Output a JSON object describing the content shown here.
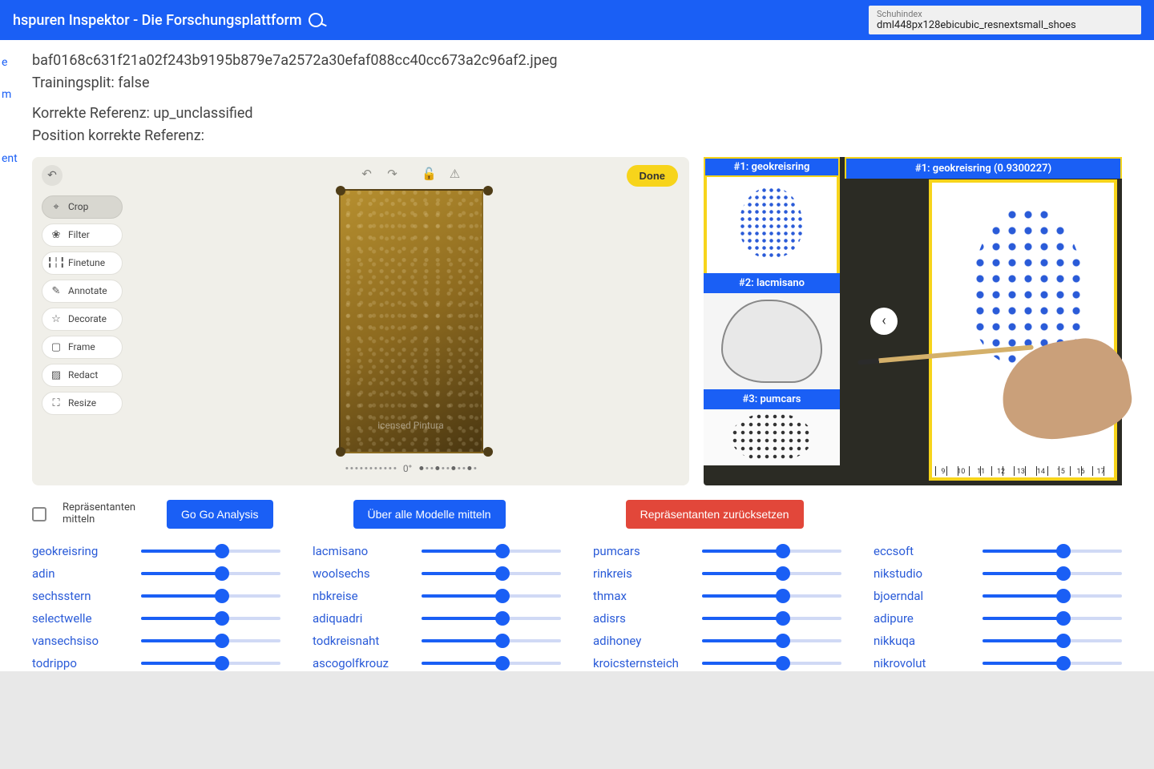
{
  "header": {
    "title": "hspuren Inspektor - Die Forschungsplattform",
    "index_label": "Schuhindex",
    "index_value": "dml448px128ebicubic_resnextsmall_shoes"
  },
  "meta": {
    "filename": "baf0168c631f21a02f243b9195b879e7a2572a30efaf088cc40cc673a2c96af2.jpeg",
    "split_label": "Trainingsplit: false",
    "ref_label": "Korrekte Referenz: up_unclassified",
    "pos_label": "Position korrekte Referenz:"
  },
  "editor": {
    "done": "Done",
    "watermark": "icensed Pintura",
    "angle": "0°",
    "tools": [
      {
        "icon": "⌖",
        "label": "Crop",
        "active": true
      },
      {
        "icon": "❀",
        "label": "Filter",
        "active": false
      },
      {
        "icon": "╏╎╏",
        "label": "Finetune",
        "active": false
      },
      {
        "icon": "✎",
        "label": "Annotate",
        "active": false
      },
      {
        "icon": "☆",
        "label": "Decorate",
        "active": false
      },
      {
        "icon": "▢",
        "label": "Frame",
        "active": false
      },
      {
        "icon": "▨",
        "label": "Redact",
        "active": false
      },
      {
        "icon": "⛶",
        "label": "Resize",
        "active": false
      }
    ]
  },
  "results": {
    "left": [
      {
        "label": "#1: geokreisring"
      },
      {
        "label": "#2: lacmisano"
      },
      {
        "label": "#3: pumcars"
      }
    ],
    "main_label": "#1: geokreisring (0.9300227)",
    "ruler_marks": [
      "9",
      "10",
      "11",
      "12",
      "13",
      "14",
      "15",
      "16",
      "17"
    ]
  },
  "controls": {
    "chk_label": "Repräsentanten mitteln",
    "btn_analysis": "Go Go Analysis",
    "btn_allmodels": "Über alle Modelle mitteln",
    "btn_reset": "Repräsentanten zurücksetzen"
  },
  "sliders": {
    "columns": [
      [
        "geokreisring",
        "adin",
        "sechsstern",
        "selectwelle",
        "vansechsiso",
        "todrippo"
      ],
      [
        "lacmisano",
        "woolsechs",
        "nbkreise",
        "adiquadri",
        "todkreisnaht",
        "ascogolfkrouz"
      ],
      [
        "pumcars",
        "rinkreis",
        "thmax",
        "adisrs",
        "adihoney",
        "kroicsternsteich"
      ],
      [
        "eccsoft",
        "nikstudio",
        "bjoerndal",
        "adipure",
        "nikkuqa",
        "nikrovolut"
      ]
    ],
    "value_pct": 58
  },
  "nav_fragment": [
    "e",
    "m",
    "ent"
  ]
}
